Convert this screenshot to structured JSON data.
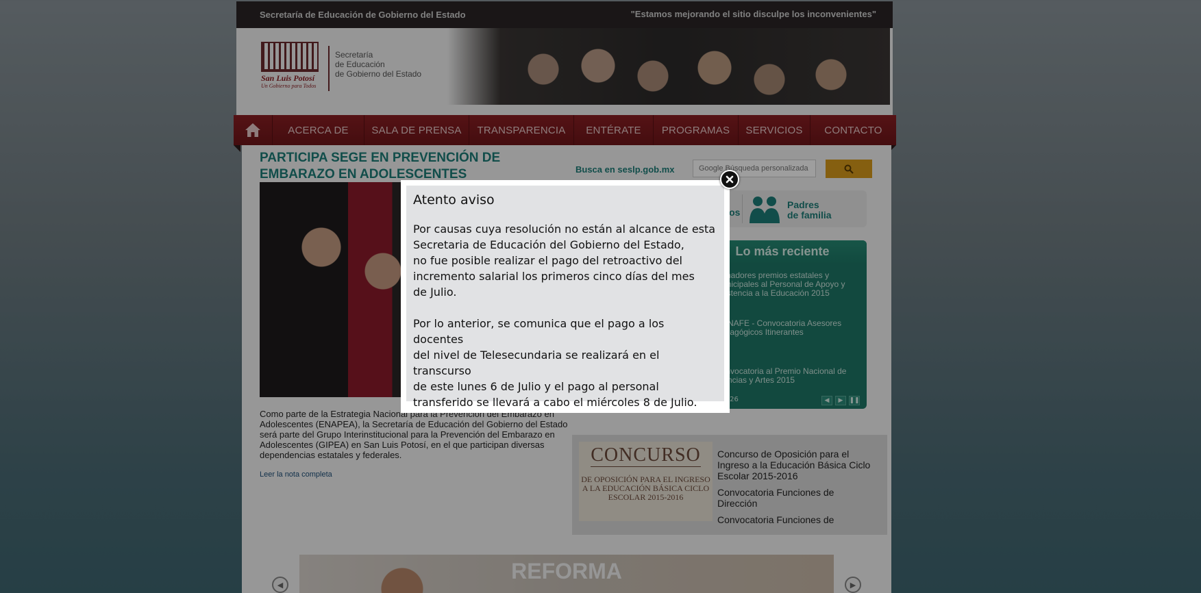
{
  "topbar": {
    "left_text": "Secretaría de Educación de Gobierno del Estado",
    "right_text": "\"Estamos mejorando el sitio disculpe los inconvenientes\""
  },
  "logo": {
    "city": "San Luis Potosí",
    "tagline": "Un Gobierno para Todos",
    "line1": "Secretaría",
    "line2": "de Educación",
    "line3": "de Gobierno del Estado"
  },
  "nav": {
    "home_icon": "home-icon",
    "items": [
      "ACERCA DE",
      "SALA DE PRENSA",
      "TRANSPARENCIA",
      "ENTÉRATE",
      "PROGRAMAS",
      "SERVICIOS",
      "CONTACTO"
    ]
  },
  "main": {
    "headline": "PARTICIPA SEGE EN PREVENCIÓN DE EMBARAZO EN ADOLESCENTES",
    "article": "Como parte de la Estrategia Nacional para la Prevención del Embarazo en Adolescentes (ENAPEA), la Secretaría de Educación del Gobierno del Estado será parte del Grupo Interinstitucional para la Prevención del Embarazo en Adolescentes (GIPEA) en San Luis Potosí, en el que participan diversas dependencias estatales y federales.",
    "read_more": "Leer la nota completa"
  },
  "search": {
    "label": "Busca en seslp.gob.mx",
    "placeholder": "Google Búsqueda personalizada",
    "button_icon": "search-icon"
  },
  "audience": {
    "maestros": "Maestros",
    "padres_line1": "Padres",
    "padres_line2": "de familia"
  },
  "recent": {
    "title": "Lo más reciente",
    "items": [
      "Ganadores premios estatales y municipales al Personal de Apoyo y Asistencia a la Educación 2015",
      "CONAFE - Convocatoria Asesores Pedagógicos Itinerantes",
      "Convocatoria al Premio Nacional de Ciencias y Artes 2015"
    ],
    "pager": "3 / 26"
  },
  "concurso": {
    "img_big": "CONCURSO",
    "img_small": "DE OPOSICIÓN PARA EL INGRESO A LA EDUCACIÓN BÁSICA CICLO ESCOLAR 2015-2016",
    "links": [
      "Concurso de Oposición para el Ingreso a la Educación Básica Ciclo Escolar 2015-2016",
      "Convocatoria Funciones de Dirección",
      "Convocatoria Funciones de"
    ]
  },
  "carousel": {
    "text": "REFORMA"
  },
  "modal": {
    "title": "Atento aviso",
    "p1": "Por causas cuya resolución no están al alcance de esta\nSecretaria de  Educación  del Gobierno del Estado,\nno fue posible realizar el pago del retroactivo del\nincremento salarial los primeros cinco días del mes\nde Julio.",
    "p2": "Por lo anterior, se comunica que el pago a los docentes\ndel nivel de Telesecundaria se realizará en el transcurso\nde este lunes 6 de Julio y el pago al personal\ntransferido se llevará a cabo el miércoles 8 de Julio."
  }
}
